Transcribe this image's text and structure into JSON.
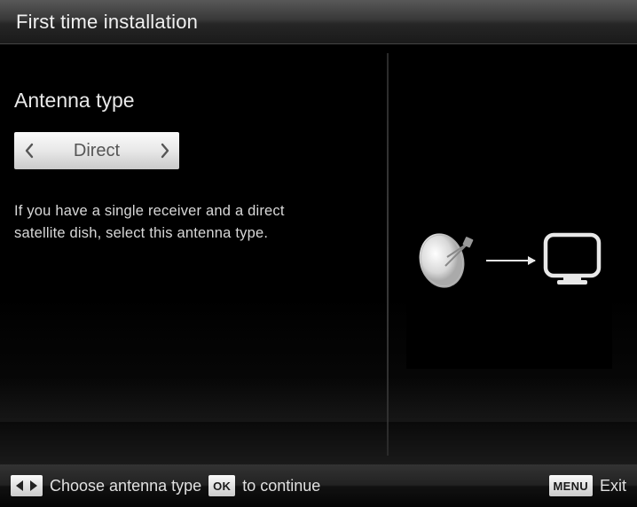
{
  "header": {
    "title": "First time installation"
  },
  "leftPane": {
    "heading": "Antenna type",
    "selector": {
      "value": "Direct"
    },
    "description": "If you have a single receiver and a direct satellite dish, select this antenna type."
  },
  "footer": {
    "hint1": "Choose antenna type",
    "okLabel": "OK",
    "hint2": "to continue",
    "menuLabel": "MENU",
    "exitLabel": "Exit"
  }
}
